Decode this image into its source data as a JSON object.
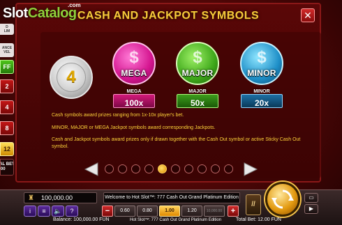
{
  "watermark": {
    "part_a": "Slot",
    "part_b": "Catalog",
    "com": ".com"
  },
  "panel": {
    "title": "CASH AND JACKPOT SYMBOLS",
    "close_label": "✕"
  },
  "symbols": {
    "cash_coin_value": "4",
    "coins": [
      {
        "label": "MEGA",
        "badge_name": "MEGA",
        "badge_value": "100x",
        "color": "#d4148f"
      },
      {
        "label": "MAJOR",
        "badge_name": "MAJOR",
        "badge_value": "50x",
        "color": "#3ea81a"
      },
      {
        "label": "MINOR",
        "badge_name": "MINOR",
        "badge_value": "20x",
        "color": "#1e8fc8"
      }
    ]
  },
  "paytable_text": [
    "Cash symbols award prizes ranging from 1x-10x player's bet.",
    "MINOR, MAJOR or MEGA Jackpot symbols award corresponding Jackpots.",
    "Cash and Jackpot symbols award prizes only if drawn together with the Cash Out symbol or active Sticky Cash Out symbol."
  ],
  "pager": {
    "page_count": 10,
    "active_page": 4
  },
  "left_strip": {
    "items": [
      "D\nLIM",
      "ANCE\nVEL",
      "FF",
      "2",
      "4",
      "8",
      "12",
      "AL BET\n.00"
    ]
  },
  "bottom": {
    "balance_value": "100,000.00",
    "ticker": "Welcome to Hot Slot™: 777 Cash Out Grand Platinum Edition",
    "bets": [
      "0.60",
      "0.80",
      "1.00",
      "1.20",
      "10,000.00"
    ],
    "selected_bet": "1.00",
    "status_balance": "Balance: 100,000.00 FUN",
    "status_game": "Hot Slot™: 777 Cash Out Grand Platinum Edition",
    "status_total_bet": "Total Bet: 12.00 FUN",
    "minus_label": "−",
    "plus_label": "+",
    "auto_label": "//",
    "info_label": "i",
    "menu_label": "≡",
    "sound_label": "🔈",
    "help_label": "?"
  },
  "colors": {
    "title_gold": "#f6c93b",
    "paytext_yellow": "#ffd43a",
    "panel_bg": "#5a0707"
  }
}
